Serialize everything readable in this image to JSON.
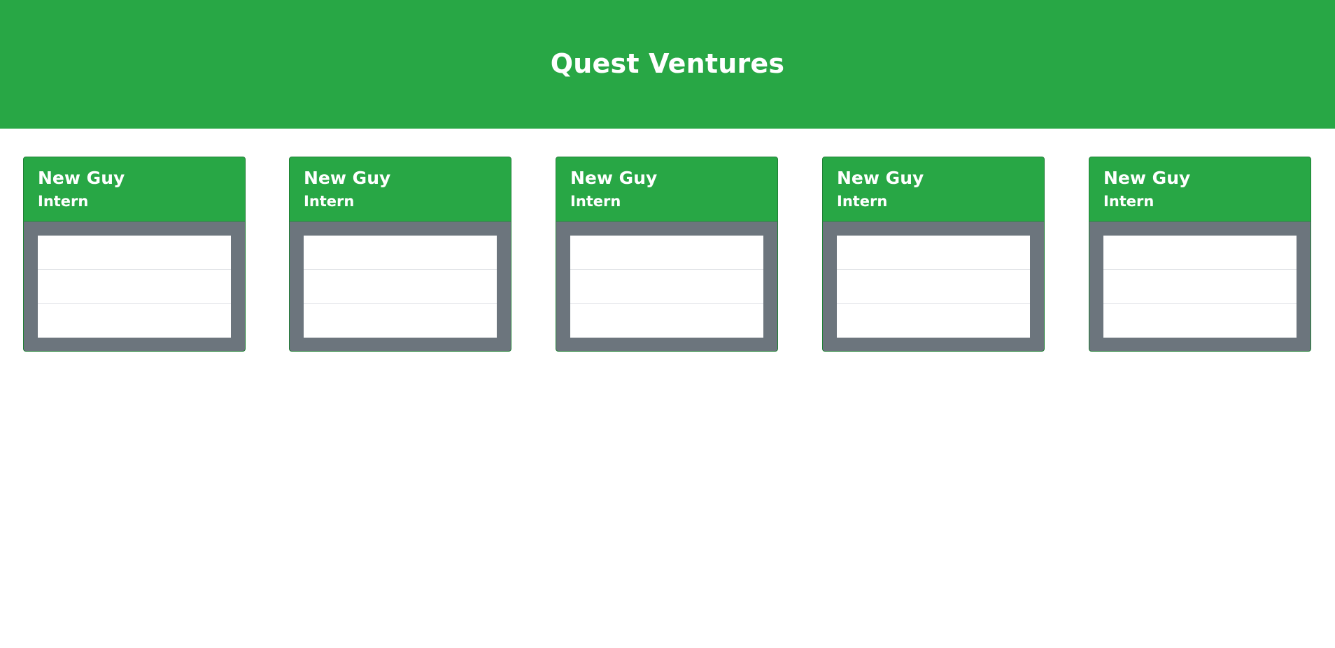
{
  "header": {
    "title": "Quest Ventures"
  },
  "cards": [
    {
      "name": "New Guy",
      "role": "Intern"
    },
    {
      "name": "New Guy",
      "role": "Intern"
    },
    {
      "name": "New Guy",
      "role": "Intern"
    },
    {
      "name": "New Guy",
      "role": "Intern"
    },
    {
      "name": "New Guy",
      "role": "Intern"
    }
  ],
  "colors": {
    "brand": "#28a745",
    "card_body": "#6c757d",
    "slot_background": "#ffffff"
  }
}
